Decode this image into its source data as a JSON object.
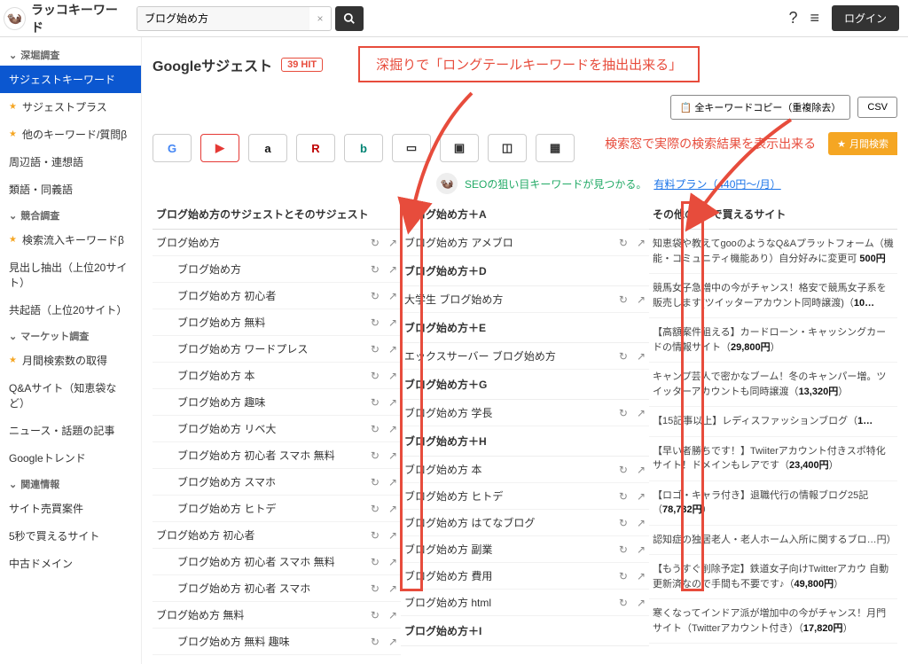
{
  "header": {
    "brand": "ラッコキーワード",
    "search_value": "ブログ始め方",
    "login": "ログイン"
  },
  "sidebar": {
    "g1": "深堀調査",
    "items1": [
      {
        "label": "サジェストキーワード",
        "active": true,
        "star": false
      },
      {
        "label": "サジェストプラス",
        "star": true
      },
      {
        "label": "他のキーワード/質問β",
        "star": true
      },
      {
        "label": "周辺語・連想語",
        "star": false
      },
      {
        "label": "類語・同義語",
        "star": false
      }
    ],
    "g2": "競合調査",
    "items2": [
      {
        "label": "検索流入キーワードβ",
        "star": true
      },
      {
        "label": "見出し抽出（上位20サイト）",
        "star": false
      },
      {
        "label": "共起語（上位20サイト）",
        "star": false
      }
    ],
    "g3": "マーケット調査",
    "items3": [
      {
        "label": "月間検索数の取得",
        "star": true
      },
      {
        "label": "Q&Aサイト（知恵袋など）",
        "star": false
      },
      {
        "label": "ニュース・話題の記事",
        "star": false
      },
      {
        "label": "Googleトレンド",
        "star": false
      }
    ],
    "g4": "関連情報",
    "items4": [
      {
        "label": "サイト売買案件",
        "star": false
      },
      {
        "label": "5秒で買えるサイト",
        "star": false
      },
      {
        "label": "中古ドメイン",
        "star": false
      }
    ]
  },
  "main": {
    "title": "Googleサジェスト",
    "hit": "39 HIT",
    "callout1": "深掘りで「ロングテールキーワードを抽出出来る」",
    "callout2": "検索窓で実際の検索結果を表示出来る",
    "copy_btn": "全キーワードコピー（重複除去）",
    "csv_btn": "CSV",
    "star_btn": "月間検索",
    "promo": "SEOの狙い目キーワードが見つかる。",
    "promo_link": "有料プラン（440円～/月）"
  },
  "col1": {
    "head": "ブログ始め方のサジェストとそのサジェスト",
    "items": [
      {
        "t": "ブログ始め方",
        "ind": 0,
        "sub": 0
      },
      {
        "t": "ブログ始め方",
        "ind": 1,
        "sub": 0
      },
      {
        "t": "ブログ始め方 初心者",
        "ind": 1,
        "sub": 0
      },
      {
        "t": "ブログ始め方 無料",
        "ind": 1,
        "sub": 0
      },
      {
        "t": "ブログ始め方 ワードプレス",
        "ind": 1,
        "sub": 0
      },
      {
        "t": "ブログ始め方 本",
        "ind": 1,
        "sub": 0
      },
      {
        "t": "ブログ始め方 趣味",
        "ind": 1,
        "sub": 0
      },
      {
        "t": "ブログ始め方 リベ大",
        "ind": 1,
        "sub": 0
      },
      {
        "t": "ブログ始め方 初心者 スマホ 無料",
        "ind": 1,
        "sub": 0
      },
      {
        "t": "ブログ始め方 スマホ",
        "ind": 1,
        "sub": 0
      },
      {
        "t": "ブログ始め方 ヒトデ",
        "ind": 1,
        "sub": 0
      },
      {
        "t": "ブログ始め方 初心者",
        "ind": 0,
        "sub": 0
      },
      {
        "t": "ブログ始め方 初心者 スマホ 無料",
        "ind": 1,
        "sub": 0
      },
      {
        "t": "ブログ始め方 初心者 スマホ",
        "ind": 1,
        "sub": 0
      },
      {
        "t": "ブログ始め方 無料",
        "ind": 0,
        "sub": 0
      },
      {
        "t": "ブログ始め方 無料 趣味",
        "ind": 1,
        "sub": 0
      }
    ]
  },
  "col2": {
    "items": [
      {
        "t": "ブログ始め方＋A",
        "sub": 1
      },
      {
        "t": "ブログ始め方 アメブロ",
        "sub": 0
      },
      {
        "t": "ブログ始め方＋D",
        "sub": 1
      },
      {
        "t": "大学生 ブログ始め方",
        "sub": 0
      },
      {
        "t": "ブログ始め方＋E",
        "sub": 1
      },
      {
        "t": "エックスサーバー ブログ始め方",
        "sub": 0
      },
      {
        "t": "ブログ始め方＋G",
        "sub": 1
      },
      {
        "t": "ブログ始め方 学長",
        "sub": 0
      },
      {
        "t": "ブログ始め方＋H",
        "sub": 1
      },
      {
        "t": "ブログ始め方 本",
        "sub": 0
      },
      {
        "t": "ブログ始め方 ヒトデ",
        "sub": 0
      },
      {
        "t": "ブログ始め方 はてなブログ",
        "sub": 0
      },
      {
        "t": "ブログ始め方 副業",
        "sub": 0
      },
      {
        "t": "ブログ始め方 費用",
        "sub": 0
      },
      {
        "t": "ブログ始め方 html",
        "sub": 0
      },
      {
        "t": "ブログ始め方＋I",
        "sub": 1
      }
    ]
  },
  "col3": {
    "head": "その他の5秒で買えるサイト",
    "ads": [
      "知恵袋や教えてgooのようなQ&Aプラットフォーム（機能・コミュニティ機能あり）自分好みに変更可 <b>500円</b>",
      "競馬女子急増中の今がチャンス！格安で競馬女子系を販売します(ツイッターアカウント同時譲渡)（<b>10…</b>",
      "【高額案件狙える】カードローン・キャッシングカードの情報サイト（<b>29,800円</b>）",
      "キャンプ芸人で密かなブーム！冬のキャンパー増。ツイッターアカウントも同時譲渡（<b>13,320円</b>）",
      "【15記事以上】レディスファッションブログ（<b>1…</b>",
      "【早い者勝ちです！】Twiiterアカウント付きスポ特化サイト！ドメインもレアです（<b>23,400円</b>）",
      "【ロゴ・キャラ付き】退職代行の情報ブログ25記（<b>78,732円</b>）",
      "認知症の独居老人・老人ホーム入所に関するブロ…円）",
      "【もうすぐ削除予定】鉄道女子向けTwitterアカウ 自動更新済なので手間も不要です♪（<b>49,800円</b>）",
      "寒くなってインドア派が増加中の今がチャンス！月門サイト（Twitterアカウント付き）（<b>17,820円</b>）"
    ]
  }
}
